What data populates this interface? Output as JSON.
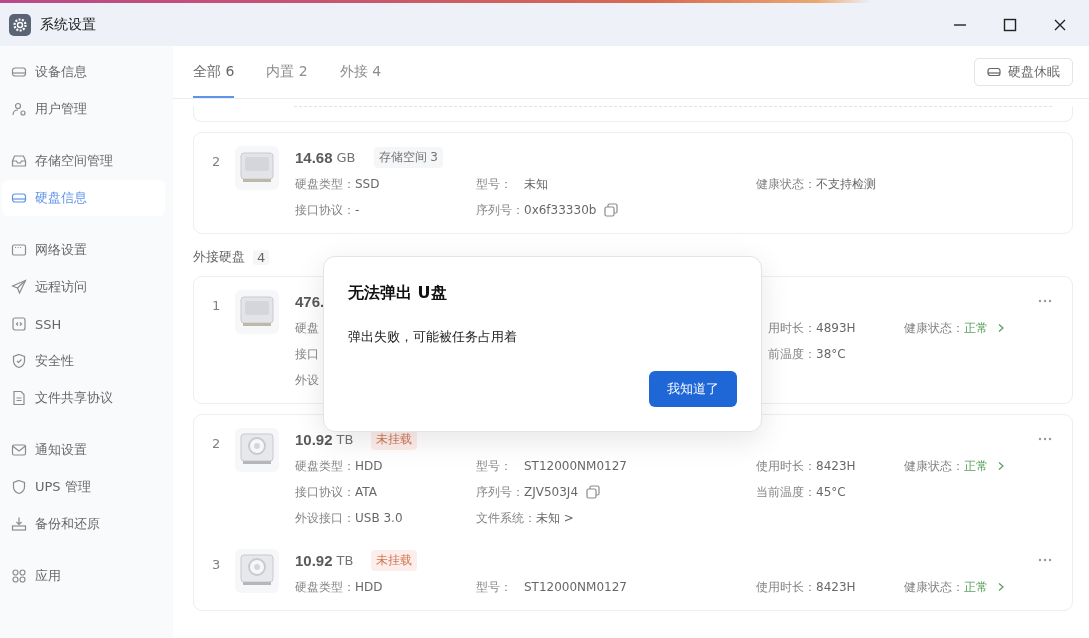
{
  "window": {
    "title": "系统设置"
  },
  "sidebar": {
    "groups": [
      [
        {
          "label": "设备信息",
          "selected": false
        },
        {
          "label": "用户管理",
          "selected": false
        }
      ],
      [
        {
          "label": "存储空间管理",
          "selected": false
        },
        {
          "label": "硬盘信息",
          "selected": true
        }
      ],
      [
        {
          "label": "网络设置",
          "selected": false
        },
        {
          "label": "远程访问",
          "selected": false
        },
        {
          "label": "SSH",
          "selected": false
        },
        {
          "label": "安全性",
          "selected": false
        },
        {
          "label": "文件共享协议",
          "selected": false
        }
      ],
      [
        {
          "label": "通知设置",
          "selected": false
        },
        {
          "label": "UPS 管理",
          "selected": false
        },
        {
          "label": "备份和还原",
          "selected": false
        }
      ],
      [
        {
          "label": "应用",
          "selected": false
        }
      ]
    ]
  },
  "tabs": [
    {
      "label": "全部 6",
      "selected": true
    },
    {
      "label": "内置 2",
      "selected": false
    },
    {
      "label": "外接 4",
      "selected": false
    }
  ],
  "sleep_button": "硬盘休眠",
  "internal_disks": [
    {
      "index": "2",
      "kind": "ssd",
      "size": "14.68",
      "unit": "GB",
      "tag": {
        "text": "存储空间 3",
        "kind": "neutral"
      },
      "more_button": false,
      "rows": [
        [
          {
            "label": "硬盘类型：",
            "value": "SSD",
            "kind": "text"
          },
          {
            "label": "型号：",
            "value": "未知",
            "kind": "text"
          },
          {
            "label": "健康状态：",
            "value": "不支持检测",
            "kind": "text"
          },
          null
        ],
        [
          {
            "label": "接口协议：",
            "value": "-",
            "kind": "text"
          },
          {
            "label": "序列号：",
            "value": "0x6f33330b",
            "kind": "copy"
          },
          null,
          null
        ]
      ]
    }
  ],
  "external_section": {
    "title": "外接硬盘",
    "count": "4"
  },
  "external_cards": [
    [
      {
        "index": "1",
        "kind": "ssd",
        "size": "476.",
        "more_button": true,
        "rows": [
          [
            {
              "label": "硬盘",
              "kind": "cut"
            },
            null,
            {
              "label": "用时长：",
              "value": "4893H",
              "kind": "text"
            },
            {
              "label": "健康状态：",
              "value": "正常",
              "kind": "status"
            }
          ],
          [
            {
              "label": "接口",
              "kind": "cut"
            },
            null,
            {
              "label": "前温度：",
              "value": "38°C",
              "kind": "text"
            },
            null
          ],
          [
            {
              "label": "外设",
              "kind": "cut"
            },
            null,
            null,
            null
          ]
        ]
      }
    ],
    [
      {
        "index": "2",
        "kind": "hdd",
        "size": "10.92",
        "unit": "TB",
        "tag": {
          "text": "未挂载",
          "kind": "warning"
        },
        "more_button": true,
        "rows": [
          [
            {
              "label": "硬盘类型：",
              "value": "HDD",
              "kind": "text"
            },
            {
              "label": "型号：",
              "value": "ST12000NM0127",
              "kind": "text"
            },
            {
              "label": "使用时长：",
              "value": "8423H",
              "kind": "text"
            },
            {
              "label": "健康状态：",
              "value": "正常",
              "kind": "status"
            }
          ],
          [
            {
              "label": "接口协议：",
              "value": "ATA",
              "kind": "text"
            },
            {
              "label": "序列号：",
              "value": "ZJV503J4",
              "kind": "copy"
            },
            {
              "label": "当前温度：",
              "value": "45°C",
              "kind": "text"
            },
            null
          ],
          [
            {
              "label": "外设接口：",
              "value": "USB 3.0",
              "kind": "text"
            },
            {
              "label": "文件系统：",
              "value": "未知 >",
              "kind": "text"
            },
            null,
            null
          ]
        ]
      },
      {
        "index": "3",
        "kind": "hdd",
        "size": "10.92",
        "unit": "TB",
        "tag": {
          "text": "未挂载",
          "kind": "warning"
        },
        "more_button": true,
        "rows": [
          [
            {
              "label": "硬盘类型：",
              "value": "HDD",
              "kind": "text"
            },
            {
              "label": "型号：",
              "value": "ST12000NM0127",
              "kind": "text"
            },
            {
              "label": "使用时长：",
              "value": "8423H",
              "kind": "text"
            },
            {
              "label": "健康状态：",
              "value": "正常",
              "kind": "status"
            }
          ]
        ]
      }
    ]
  ],
  "dialog": {
    "title": "无法弹出 U盘",
    "message": "弹出失败，可能被任务占用着",
    "button": "我知道了"
  }
}
